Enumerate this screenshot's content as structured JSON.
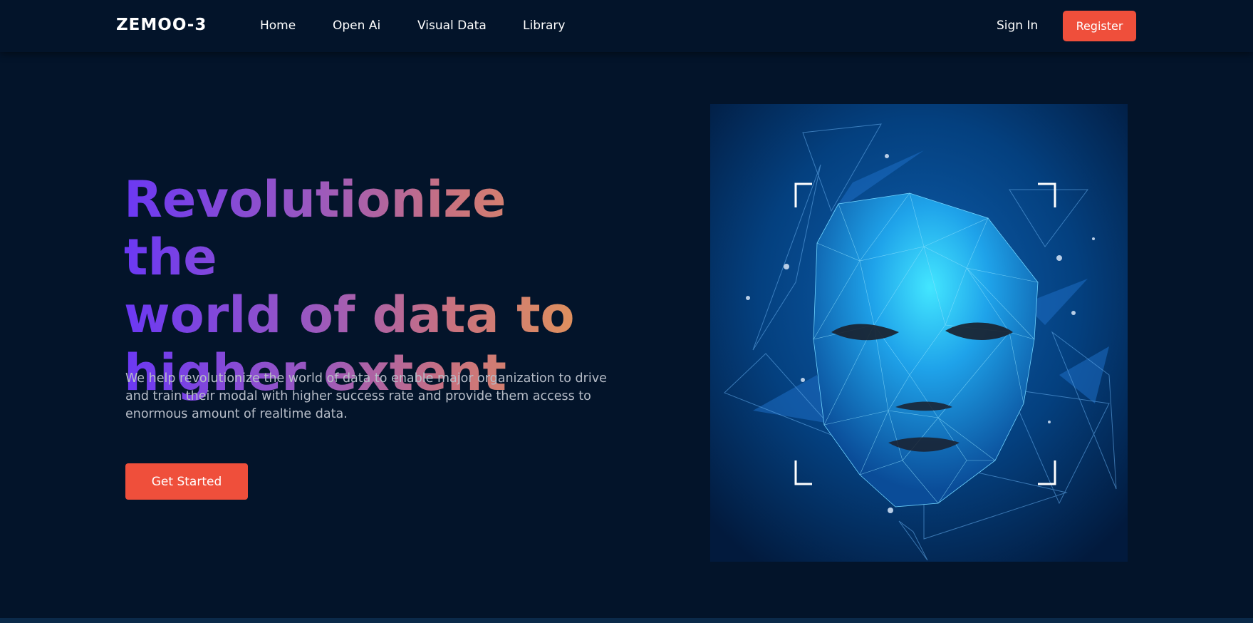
{
  "brand": {
    "name": "ZEMOO-3"
  },
  "nav": {
    "items": [
      {
        "label": "Home"
      },
      {
        "label": "Open Ai"
      },
      {
        "label": "Visual Data"
      },
      {
        "label": "Library"
      }
    ],
    "signin_label": "Sign In",
    "register_label": "Register"
  },
  "hero": {
    "title_line1": "Revolutionize the",
    "title_line2": "world of data to",
    "title_line3": "higher extent",
    "description": "We help revolutionize the world of data to enable major organization to drive and train their modal with higher success rate and provide them access to enormous amount of realtime data.",
    "cta_label": "Get Started",
    "image_icon": "polygonal-face-illustration"
  },
  "colors": {
    "background": "#03142a",
    "accent": "#ef4f3b",
    "gradient_start": "#6b38f4",
    "gradient_end": "#e29559"
  }
}
